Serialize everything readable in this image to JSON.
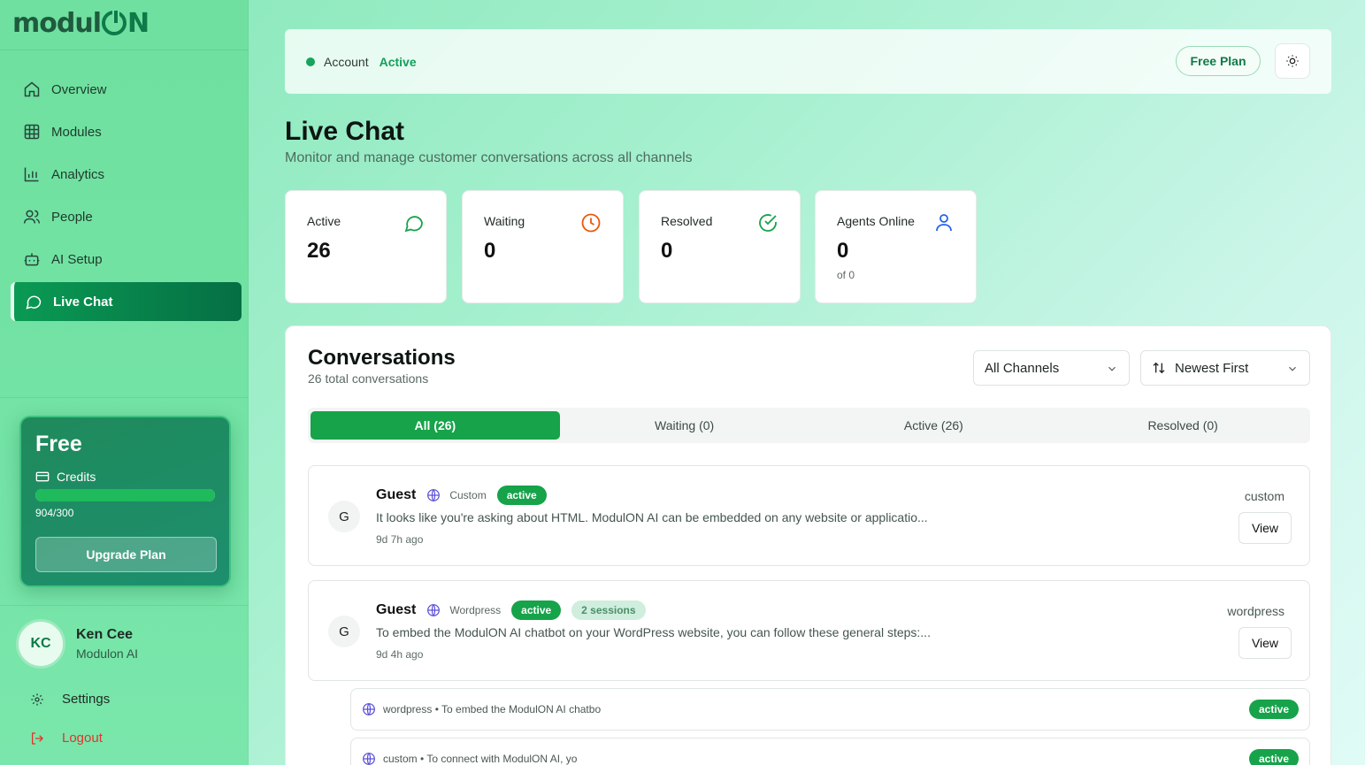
{
  "brand": {
    "logo_prefix": "modul",
    "logo_suffix": "N"
  },
  "sidebar": {
    "nav": [
      {
        "label": "Overview",
        "icon": "home-icon"
      },
      {
        "label": "Modules",
        "icon": "grid-icon"
      },
      {
        "label": "Analytics",
        "icon": "bar-chart-icon"
      },
      {
        "label": "People",
        "icon": "users-icon"
      },
      {
        "label": "AI Setup",
        "icon": "bot-icon"
      },
      {
        "label": "Live Chat",
        "icon": "chat-icon",
        "active": true
      }
    ],
    "plan": {
      "title": "Free",
      "credits_label": "Credits",
      "credits_used": 904,
      "credits_total": 300,
      "credits_text": "904/300",
      "progress_fraction": 1.0,
      "upgrade_label": "Upgrade Plan"
    },
    "user": {
      "initials": "KC",
      "name": "Ken Cee",
      "org": "Modulon AI"
    },
    "settings_label": "Settings",
    "logout_label": "Logout"
  },
  "topbar": {
    "account_label": "Account",
    "account_status": "Active",
    "plan_button": "Free Plan",
    "theme_icon": "sun-icon"
  },
  "page": {
    "title": "Live Chat",
    "subtitle": "Monitor and manage customer conversations across all channels"
  },
  "stats": [
    {
      "label": "Active",
      "value": "26",
      "sub": "",
      "icon": "chat-icon",
      "color": "#16a34a"
    },
    {
      "label": "Waiting",
      "value": "0",
      "sub": "",
      "icon": "clock-icon",
      "color": "#ea580c"
    },
    {
      "label": "Resolved",
      "value": "0",
      "sub": "",
      "icon": "check-circle-icon",
      "color": "#16a34a"
    },
    {
      "label": "Agents Online",
      "value": "0",
      "sub": "of 0",
      "icon": "user-icon",
      "color": "#2563eb"
    }
  ],
  "conversations": {
    "title": "Conversations",
    "subtitle": "26 total conversations",
    "channel_filter": "All Channels",
    "sort": "Newest First",
    "tabs": [
      {
        "label": "All (26)",
        "active": true
      },
      {
        "label": "Waiting (0)"
      },
      {
        "label": "Active (26)"
      },
      {
        "label": "Resolved (0)"
      }
    ],
    "items": [
      {
        "initial": "G",
        "name": "Guest",
        "channel": "Custom",
        "status": "active",
        "sessions": "",
        "message": "It looks like you're asking about HTML. ModulON AI can be embedded on any website or applicatio...",
        "time": "9d 7h ago",
        "source": "custom",
        "view_label": "View"
      },
      {
        "initial": "G",
        "name": "Guest",
        "channel": "Wordpress",
        "status": "active",
        "sessions": "2 sessions",
        "message": "To embed the ModulON AI chatbot on your WordPress website, you can follow these general steps:...",
        "time": "9d 4h ago",
        "source": "wordpress",
        "view_label": "View"
      }
    ],
    "sessions": [
      {
        "text": "wordpress • To embed the ModulON AI chatbo",
        "status": "active"
      },
      {
        "text": "custom • To connect with ModulON AI, yo",
        "status": "active"
      }
    ]
  },
  "colors": {
    "accent": "#16a34a",
    "sidebar_active": "#056f44",
    "logout": "#e5322d"
  }
}
